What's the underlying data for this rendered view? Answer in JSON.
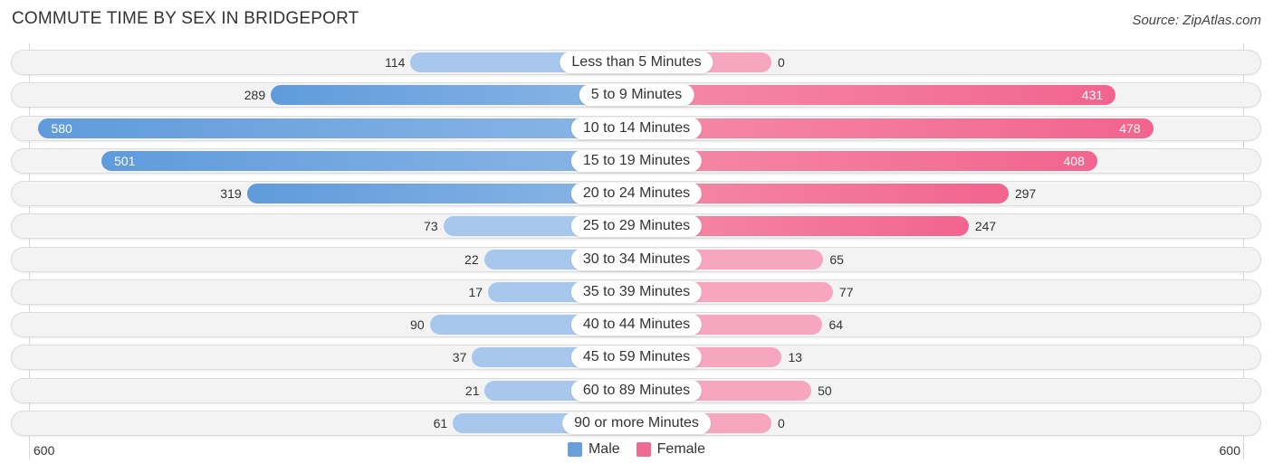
{
  "header": {
    "title": "COMMUTE TIME BY SEX IN BRIDGEPORT",
    "source": "Source: ZipAtlas.com"
  },
  "colors": {
    "male": "#6a9fdd",
    "female": "#f06a94",
    "male_light": "#a7c8ec",
    "female_light": "#f6a7bf"
  },
  "chart_data": {
    "type": "bar",
    "orientation": "horizontal-diverging",
    "title": "COMMUTE TIME BY SEX IN BRIDGEPORT",
    "categories": [
      "Less than 5 Minutes",
      "5 to 9 Minutes",
      "10 to 14 Minutes",
      "15 to 19 Minutes",
      "20 to 24 Minutes",
      "25 to 29 Minutes",
      "30 to 34 Minutes",
      "35 to 39 Minutes",
      "40 to 44 Minutes",
      "45 to 59 Minutes",
      "60 to 89 Minutes",
      "90 or more Minutes"
    ],
    "series": [
      {
        "name": "Male",
        "values": [
          114,
          289,
          580,
          501,
          319,
          73,
          22,
          17,
          90,
          37,
          21,
          61
        ]
      },
      {
        "name": "Female",
        "values": [
          0,
          431,
          478,
          408,
          297,
          247,
          65,
          77,
          64,
          13,
          50,
          0
        ]
      }
    ],
    "axis": {
      "left_max_label": "600",
      "right_max_label": "600",
      "range": [
        0,
        600
      ]
    },
    "legend": {
      "position": "bottom-center",
      "entries": [
        "Male",
        "Female"
      ]
    },
    "xlabel": "",
    "ylabel": ""
  }
}
